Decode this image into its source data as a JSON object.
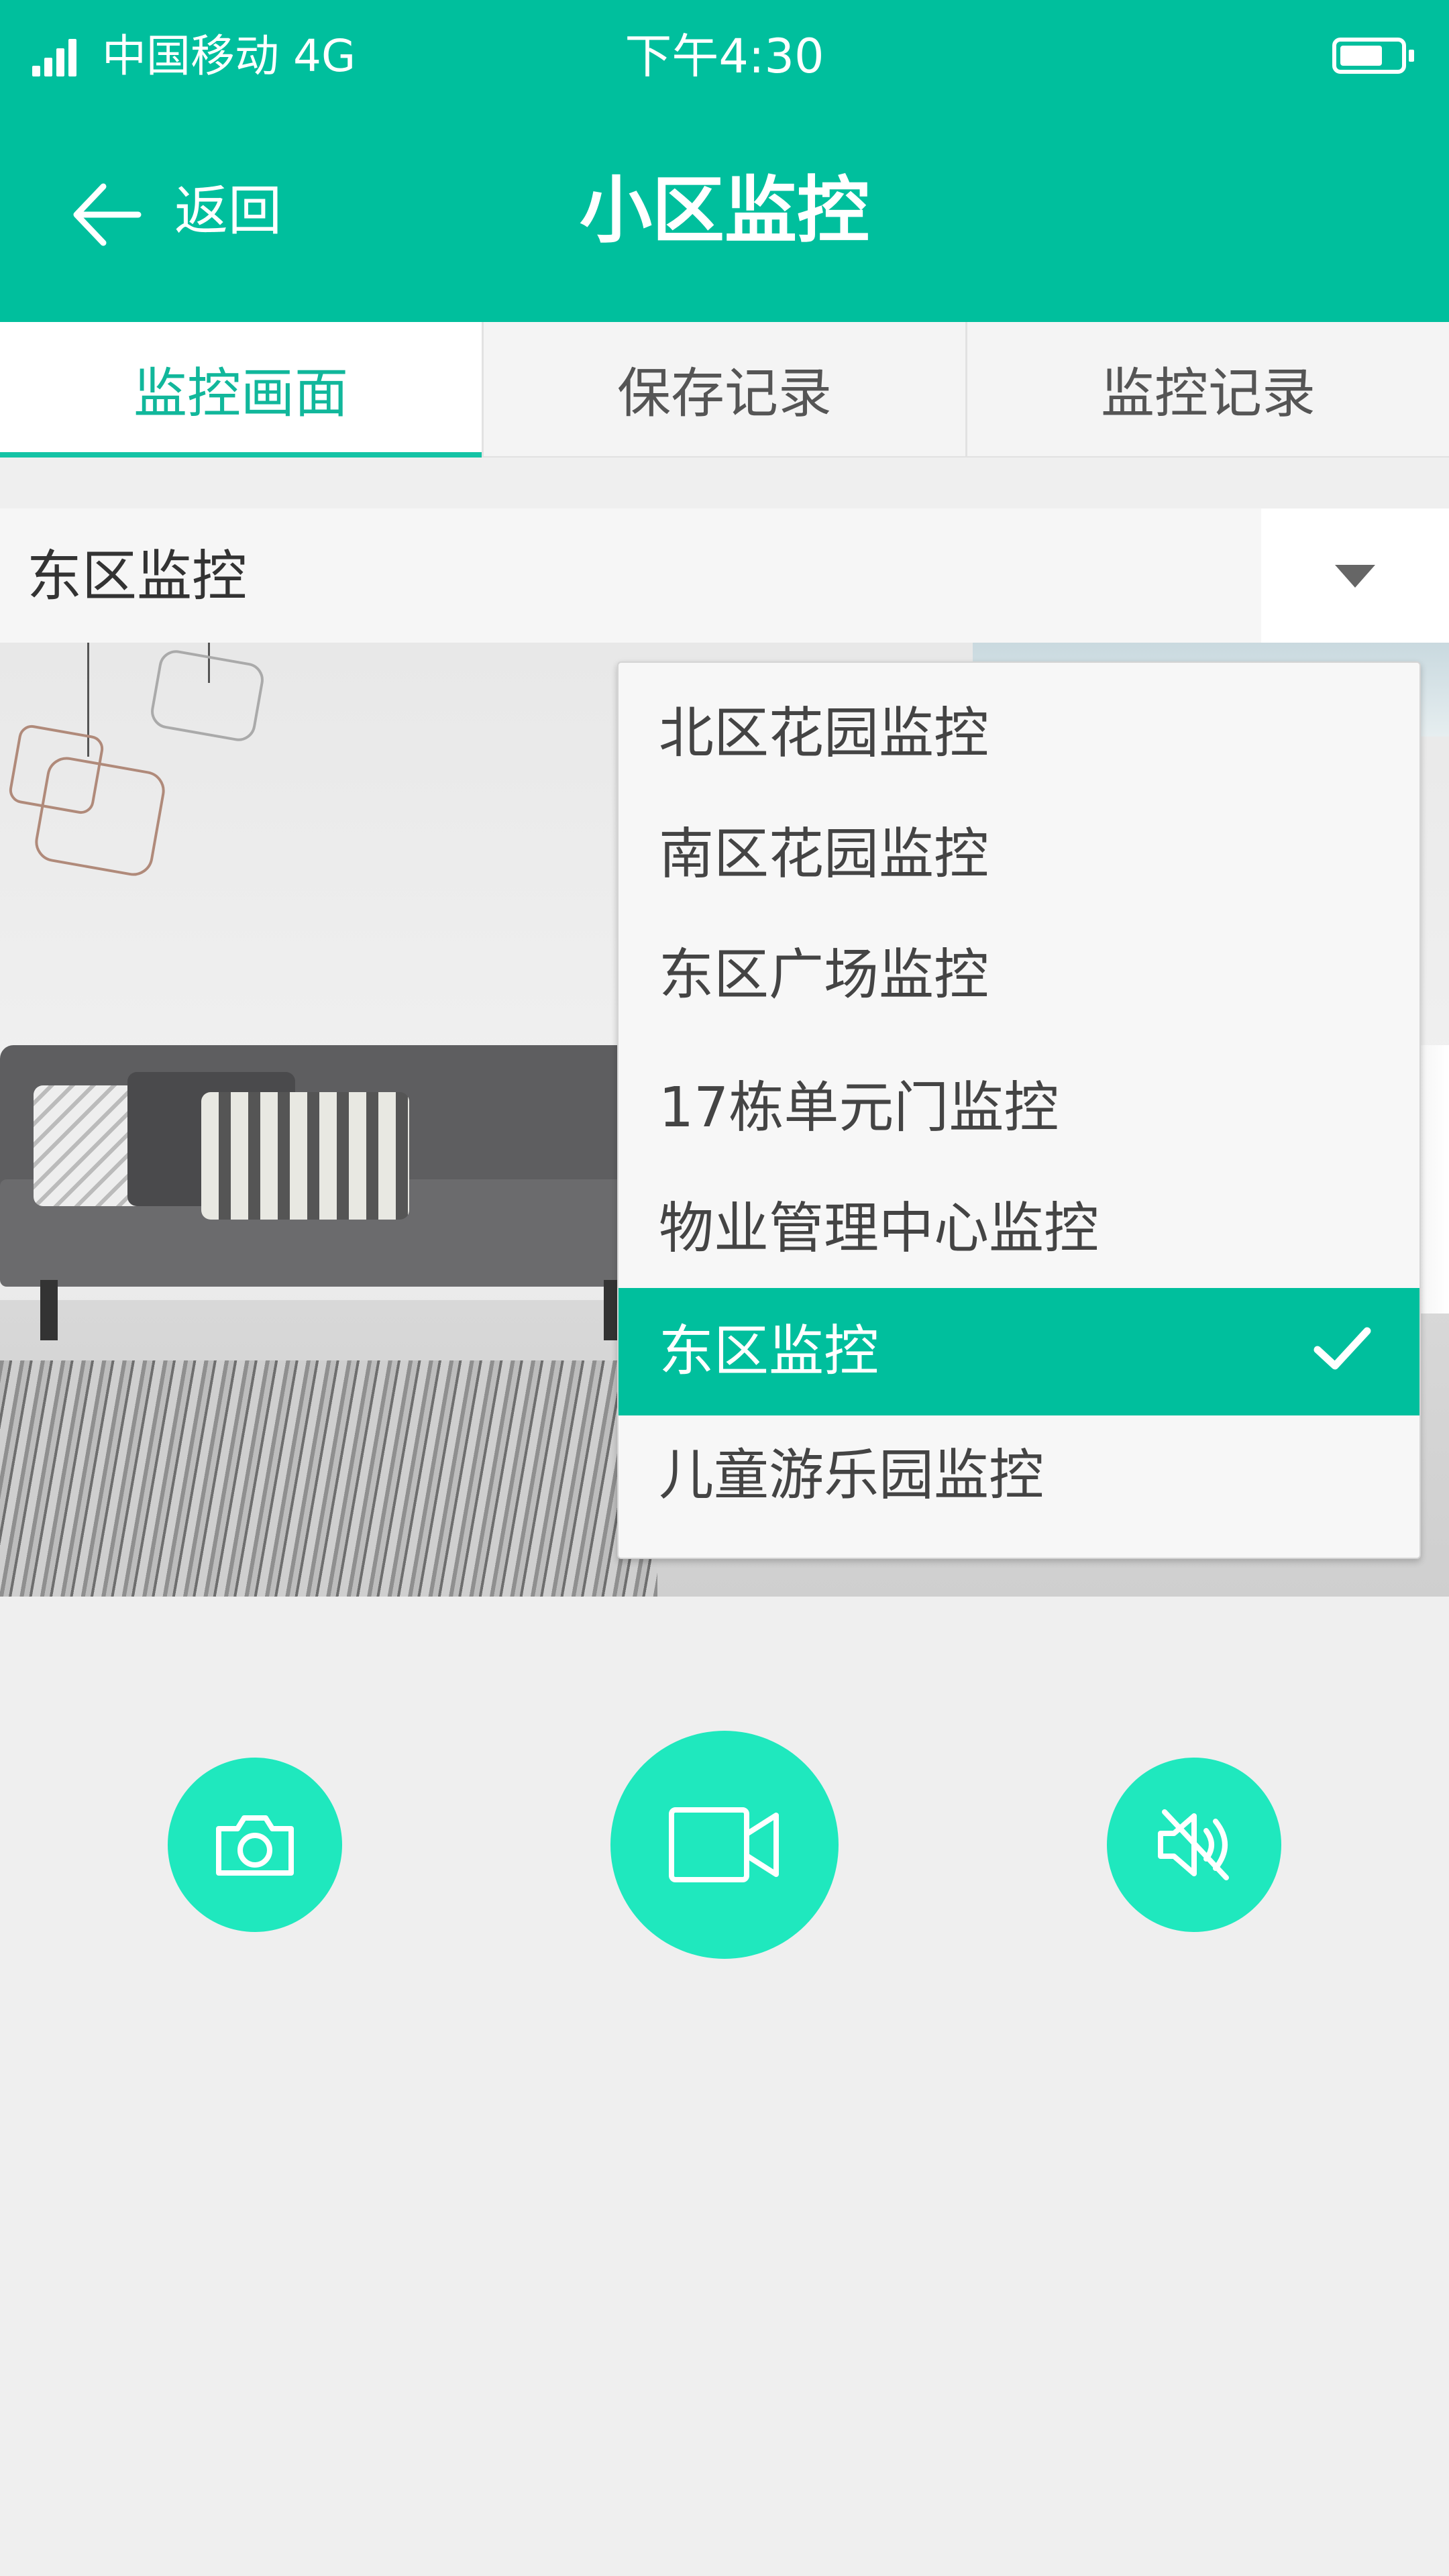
{
  "status_bar": {
    "carrier": "中国移动  4G",
    "time": "下午4:30"
  },
  "header": {
    "back_label": "返回",
    "title": "小区监控"
  },
  "tabs": [
    {
      "label": "监控画面",
      "active": true
    },
    {
      "label": "保存记录",
      "active": false
    },
    {
      "label": "监控记录",
      "active": false
    }
  ],
  "selector": {
    "value": "东区监控"
  },
  "dropdown": {
    "items": [
      {
        "label": "北区花园监控",
        "selected": false
      },
      {
        "label": "南区花园监控",
        "selected": false
      },
      {
        "label": "东区广场监控",
        "selected": false
      },
      {
        "label": "17栋单元门监控",
        "selected": false
      },
      {
        "label": "物业管理中心监控",
        "selected": false
      },
      {
        "label": "东区监控",
        "selected": true
      },
      {
        "label": "儿童游乐园监控",
        "selected": false
      }
    ]
  },
  "controls": [
    {
      "icon": "camera-icon"
    },
    {
      "icon": "video-camera-icon"
    },
    {
      "icon": "speaker-mute-icon"
    }
  ],
  "colors": {
    "accent": "#00bf9d",
    "button": "#1fe8be",
    "active_tab_text": "#11b79b"
  }
}
